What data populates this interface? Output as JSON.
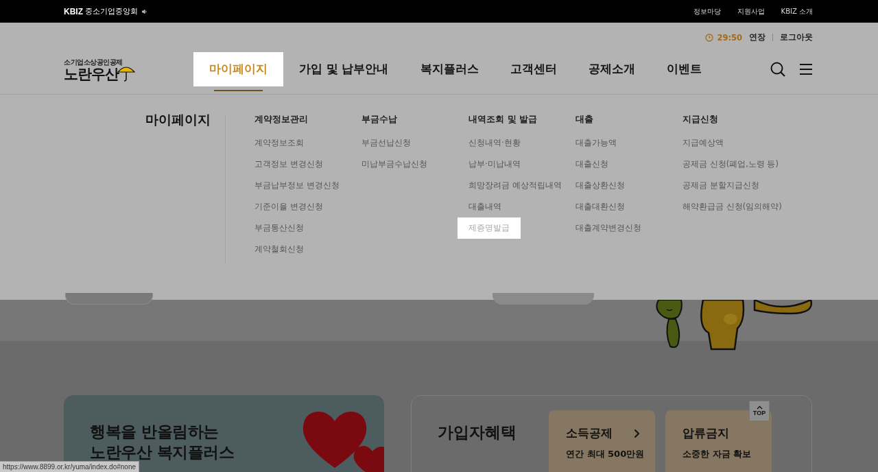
{
  "top_bar": {
    "brand": "KBIZ",
    "org": "중소기업중앙회",
    "links": [
      "정보마당",
      "지원사업",
      "KBIZ 소개"
    ]
  },
  "session": {
    "timer": "29:50",
    "extend": "연장",
    "logout": "로그아웃"
  },
  "logo": {
    "subtitle": "소기업소상공인공제",
    "name": "노란우산"
  },
  "nav": {
    "items": [
      {
        "label": "마이페이지",
        "selected": true
      },
      {
        "label": "가입 및 납부안내",
        "selected": false
      },
      {
        "label": "복지플러스",
        "selected": false
      },
      {
        "label": "고객센터",
        "selected": false
      },
      {
        "label": "공제소개",
        "selected": false
      },
      {
        "label": "이벤트",
        "selected": false
      }
    ]
  },
  "mega_menu": {
    "title": "마이페이지",
    "columns": [
      {
        "heading": "계약정보관리",
        "items": [
          {
            "label": "계약정보조회",
            "selected": false
          },
          {
            "label": "고객정보 변경신청",
            "selected": false
          },
          {
            "label": "부금납부정보 변경신청",
            "selected": false
          },
          {
            "label": "기준이율 변경신청",
            "selected": false
          },
          {
            "label": "부금통산신청",
            "selected": false
          },
          {
            "label": "계약철회신청",
            "selected": false
          }
        ]
      },
      {
        "heading": "부금수납",
        "items": [
          {
            "label": "부금선납신청",
            "selected": false
          },
          {
            "label": "미납부금수납신청",
            "selected": false
          }
        ]
      },
      {
        "heading": "내역조회 및 발급",
        "items": [
          {
            "label": "신청내역·현황",
            "selected": false
          },
          {
            "label": "납부·미납내역",
            "selected": false
          },
          {
            "label": "희망장려금 예상적립내역",
            "selected": false
          },
          {
            "label": "대출내역",
            "selected": false
          },
          {
            "label": "제증명발급",
            "selected": true
          }
        ]
      },
      {
        "heading": "대출",
        "items": [
          {
            "label": "대출가능액",
            "selected": false
          },
          {
            "label": "대출신청",
            "selected": false
          },
          {
            "label": "대출상환신청",
            "selected": false
          },
          {
            "label": "대출대환신청",
            "selected": false
          },
          {
            "label": "대출계약변경신청",
            "selected": false
          }
        ]
      },
      {
        "heading": "지급신청",
        "items": [
          {
            "label": "지급예상액",
            "selected": false
          },
          {
            "label": "공제금 신청(폐업,노령 등)",
            "selected": false
          },
          {
            "label": "공제금 분할지급신청",
            "selected": false
          },
          {
            "label": "해약환급금 신청(임의해약)",
            "selected": false
          }
        ]
      }
    ]
  },
  "banner": {
    "title_lines": [
      "행복을 반올림하는",
      "노란우산 복지플러스"
    ]
  },
  "benefits": {
    "title": "가입자혜택",
    "cards": [
      {
        "kind": "link",
        "title": "소득공제",
        "subtitle": "연간 최대 500만원"
      },
      {
        "kind": "plain",
        "title": "압류금지",
        "subtitle": "소중한 자금 확보"
      }
    ]
  },
  "top_button": "TOP",
  "status_url": "https://www.8899.or.kr/yuma/index.do#none"
}
